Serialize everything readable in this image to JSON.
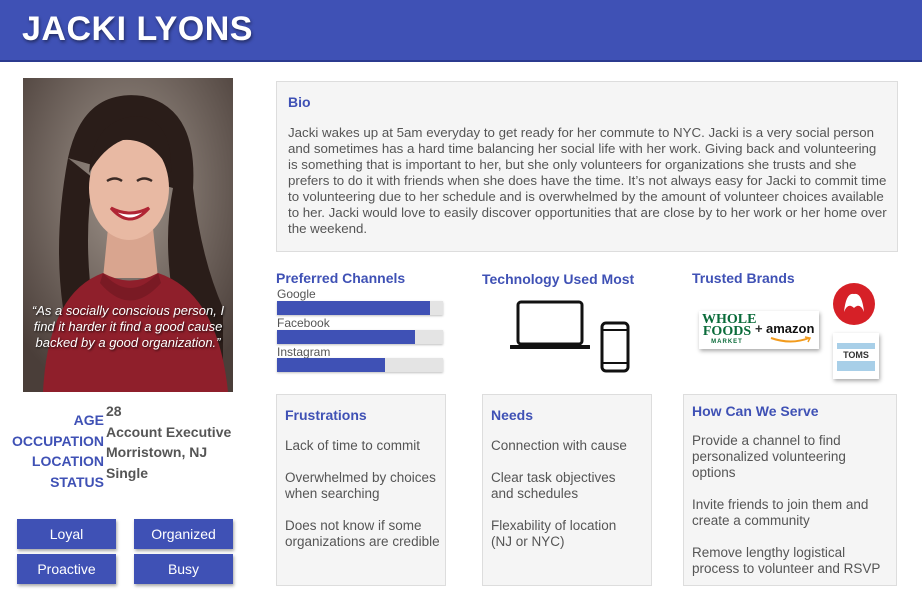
{
  "header": {
    "name": "JACKI LYONS"
  },
  "photo": {
    "quote": "“As a socially conscious person, I find it harder it find a good cause backed by a good organization.”"
  },
  "demographics": {
    "labels": [
      "AGE",
      "OCCUPATION",
      "LOCATION",
      "STATUS"
    ],
    "values": [
      "28",
      "Account Executive",
      "Morristown, NJ",
      "Single"
    ]
  },
  "traits": [
    "Loyal",
    "Organized",
    "Proactive",
    "Busy"
  ],
  "bio": {
    "title": "Bio",
    "text": "Jacki wakes up at 5am everyday to get ready for her commute to NYC. Jacki is a very social person and sometimes has a hard time balancing her social life with her work. Giving back and volunteering is something that is important to her, but she only volunteers for organizations she trusts and she prefers to do it with friends when she does have the time. It’s not always easy for Jacki to commit time to volunteering due to her schedule and is overwhelmed by the amount of volunteer choices available to her. Jacki would love to easily discover opportunities that are close by to her work or her home over the weekend."
  },
  "channels": {
    "title": "Preferred Channels",
    "items": [
      {
        "label": "Google",
        "fraction": 0.92
      },
      {
        "label": "Facebook",
        "fraction": 0.83
      },
      {
        "label": "Instagram",
        "fraction": 0.65
      }
    ]
  },
  "technology": {
    "title": "Technology Used Most",
    "icons": [
      "laptop-icon",
      "smartphone-icon"
    ]
  },
  "brands": {
    "title": "Trusted Brands",
    "logos": {
      "wholefoods_line1": "WHOLE",
      "wholefoods_line2": "FOODS",
      "wholefoods_line3": "MARKET",
      "plus": "+",
      "amazon": "amazon",
      "toms": "TOMS"
    },
    "icons": [
      "lululemon-logo"
    ]
  },
  "frustrations": {
    "title": "Frustrations",
    "items": [
      "Lack of time to commit",
      "Overwhelmed by choices when searching",
      "Does not know if some organizations are credible"
    ]
  },
  "needs": {
    "title": "Needs",
    "items": [
      "Connection with cause",
      "Clear task objectives and schedules",
      "Flexability of location (NJ or NYC)"
    ]
  },
  "serve": {
    "title": "How Can We Serve",
    "items": [
      "Provide a channel to find personalized volunteering options",
      "Invite friends to join them and create a community",
      "Remove lengthy logistical process to volunteer and RSVP"
    ]
  },
  "colors": {
    "accent": "#3f51b5",
    "card": "#f5f5f5",
    "text": "#555555",
    "lululemon": "#d62027"
  }
}
